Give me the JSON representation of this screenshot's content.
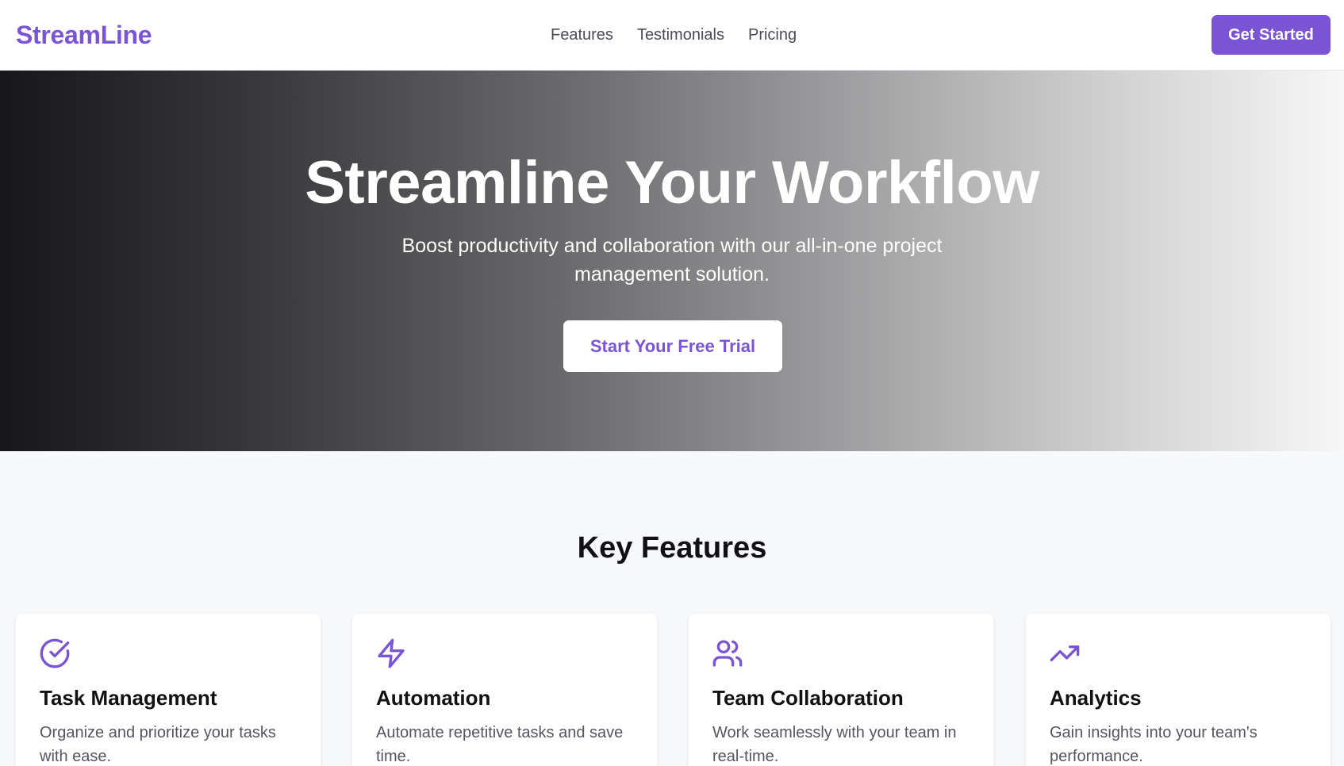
{
  "header": {
    "logo": "StreamLine",
    "nav": [
      {
        "label": "Features"
      },
      {
        "label": "Testimonials"
      },
      {
        "label": "Pricing"
      }
    ],
    "cta_label": "Get Started"
  },
  "hero": {
    "title": "Streamline Your Workflow",
    "subtitle": "Boost productivity and collaboration with our all-in-one project management solution.",
    "cta_label": "Start Your Free Trial"
  },
  "features": {
    "title": "Key Features",
    "items": [
      {
        "icon": "check-circle-icon",
        "title": "Task Management",
        "description": "Organize and prioritize your tasks with ease."
      },
      {
        "icon": "lightning-icon",
        "title": "Automation",
        "description": "Automate repetitive tasks and save time."
      },
      {
        "icon": "users-icon",
        "title": "Team Collaboration",
        "description": "Work seamlessly with your team in real-time."
      },
      {
        "icon": "trending-up-icon",
        "title": "Analytics",
        "description": "Gain insights into your team's performance."
      }
    ]
  },
  "colors": {
    "accent": "#7b54d6",
    "text_dark": "#111114",
    "text_muted": "#555560",
    "background": "#f8f9fb"
  }
}
